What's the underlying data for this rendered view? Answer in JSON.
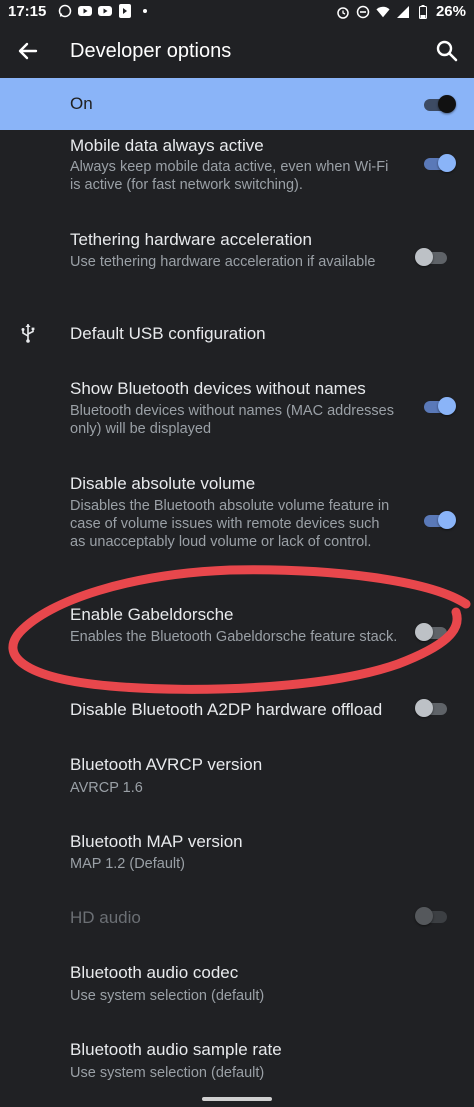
{
  "status_bar": {
    "time": "17:15",
    "battery": "26%"
  },
  "app_bar": {
    "title": "Developer options"
  },
  "master_toggle": {
    "label": "On",
    "state": "on"
  },
  "settings": [
    {
      "title": "Mobile data always active",
      "summary": "Always keep mobile data active, even when Wi-Fi is active (for fast network switching).",
      "toggle": "on"
    },
    {
      "title": "Tethering hardware acceleration",
      "summary": "Use tethering hardware acceleration if available",
      "toggle": "off"
    },
    {
      "title": "Default USB configuration",
      "icon": "usb-icon"
    },
    {
      "title": "Show Bluetooth devices without names",
      "summary": "Bluetooth devices without names (MAC addresses only) will be displayed",
      "toggle": "on"
    },
    {
      "title": "Disable absolute volume",
      "summary": "Disables the Bluetooth absolute volume feature in case of volume issues with remote devices such as unacceptably loud volume or lack of control.",
      "toggle": "on"
    },
    {
      "title": "Enable Gabeldorsche",
      "summary": "Enables the Bluetooth Gabeldorsche feature stack.",
      "toggle": "off"
    },
    {
      "title": "Disable Bluetooth A2DP hardware offload",
      "toggle": "off"
    },
    {
      "title": "Bluetooth AVRCP version",
      "summary": "AVRCP 1.6"
    },
    {
      "title": "Bluetooth MAP version",
      "summary": "MAP 1.2 (Default)"
    },
    {
      "title": "HD audio",
      "toggle": "disabled"
    },
    {
      "title": "Bluetooth audio codec",
      "summary": "Use system selection (default)"
    },
    {
      "title": "Bluetooth audio sample rate",
      "summary": "Use system selection (default)"
    }
  ],
  "colors": {
    "background": "#202124",
    "accent": "#8ab4f8",
    "annotation": "#e8474c"
  }
}
